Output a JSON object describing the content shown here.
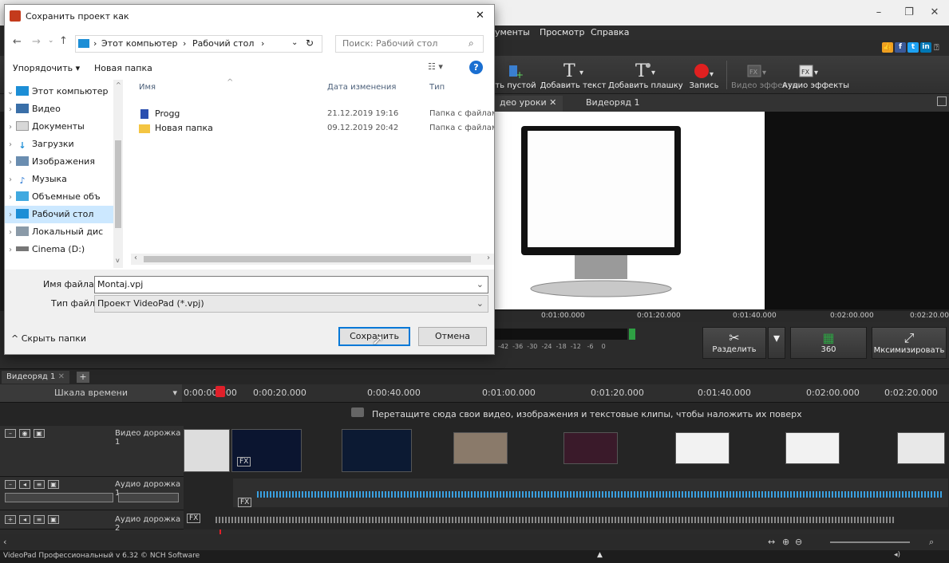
{
  "app": {
    "menu": [
      "ументы",
      "Просмотр",
      "Справка"
    ],
    "toolbar": [
      {
        "label": "ть пустой",
        "icon": "add-blank-icon"
      },
      {
        "label": "Добавить текст",
        "icon": "text-icon"
      },
      {
        "label": "Добавить плашку",
        "icon": "title-icon"
      },
      {
        "label": "Запись",
        "icon": "record-icon"
      },
      {
        "label": "Видео эффекты",
        "icon": "video-fx-icon"
      },
      {
        "label": "Аудио эффекты",
        "icon": "audio-fx-icon"
      }
    ],
    "tabs": {
      "clip": "део уроки",
      "sequence": "Видеоряд 1"
    },
    "preview_ruler": [
      "0:01:00.000",
      "0:01:20.000",
      "0:01:40.000",
      "0:02:00.000",
      "0:02:20.00"
    ],
    "audio_meter": "-42  -36  -30  -24  -18  -12   -6    0",
    "controls": {
      "split": "Разделить",
      "vr": "360",
      "maximize": "Мксимизировать"
    }
  },
  "timeline": {
    "seq_tab": "Видеоряд 1",
    "scale_label": "Шкала времени",
    "ticks": [
      "0:00:00.000",
      "0:00:20.000",
      "0:00:40.000",
      "0:01:00.000",
      "0:01:20.000",
      "0:01:40.000",
      "0:02:00.000",
      "0:02:20.000"
    ],
    "overlay_hint": "Перетащите сюда свои видео, изображения и текстовые клипы, чтобы наложить их поверх",
    "tracks": {
      "video1": "Видео дорожка 1",
      "audio1": "Аудио дорожка 1",
      "audio2": "Аудио дорожка 2"
    },
    "fx": "FX"
  },
  "status": "VideoPad Профессиональный v 6.32 © NCH Software",
  "dialog": {
    "title": "Сохранить проект как",
    "breadcrumb": [
      "Этот компьютер",
      "Рабочий стол"
    ],
    "search_placeholder": "Поиск: Рабочий стол",
    "organize": "Упорядочить ▾",
    "new_folder": "Новая папка",
    "nav": [
      {
        "label": "Этот компьютер",
        "icon": "computer-icon",
        "expanded": true
      },
      {
        "label": "Видео",
        "icon": "video-folder-icon"
      },
      {
        "label": "Документы",
        "icon": "documents-icon"
      },
      {
        "label": "Загрузки",
        "icon": "downloads-icon"
      },
      {
        "label": "Изображения",
        "icon": "pictures-icon"
      },
      {
        "label": "Музыка",
        "icon": "music-icon"
      },
      {
        "label": "Объемные объ",
        "icon": "3d-objects-icon"
      },
      {
        "label": "Рабочий стол",
        "icon": "desktop-icon",
        "selected": true
      },
      {
        "label": "Локальный дис",
        "icon": "local-disk-icon"
      },
      {
        "label": "Cinema (D:)",
        "icon": "drive-icon"
      }
    ],
    "columns": {
      "name": "Имя",
      "date": "Дата изменения",
      "type": "Тип"
    },
    "files": [
      {
        "name": "Progg",
        "date": "21.12.2019 19:16",
        "type": "Папка с файлами",
        "icon": "videopad-project-icon"
      },
      {
        "name": "Новая папка",
        "date": "09.12.2019 20:42",
        "type": "Папка с файлами",
        "icon": "folder-icon"
      }
    ],
    "filename_label": "Имя файла:",
    "filename_value": "Montaj.vpj",
    "filetype_label": "Тип файла:",
    "filetype_value": "Проект VideoPad (*.vpj)",
    "hide_folders": "Скрыть папки",
    "save": "Сохранить",
    "cancel": "Отмена"
  }
}
